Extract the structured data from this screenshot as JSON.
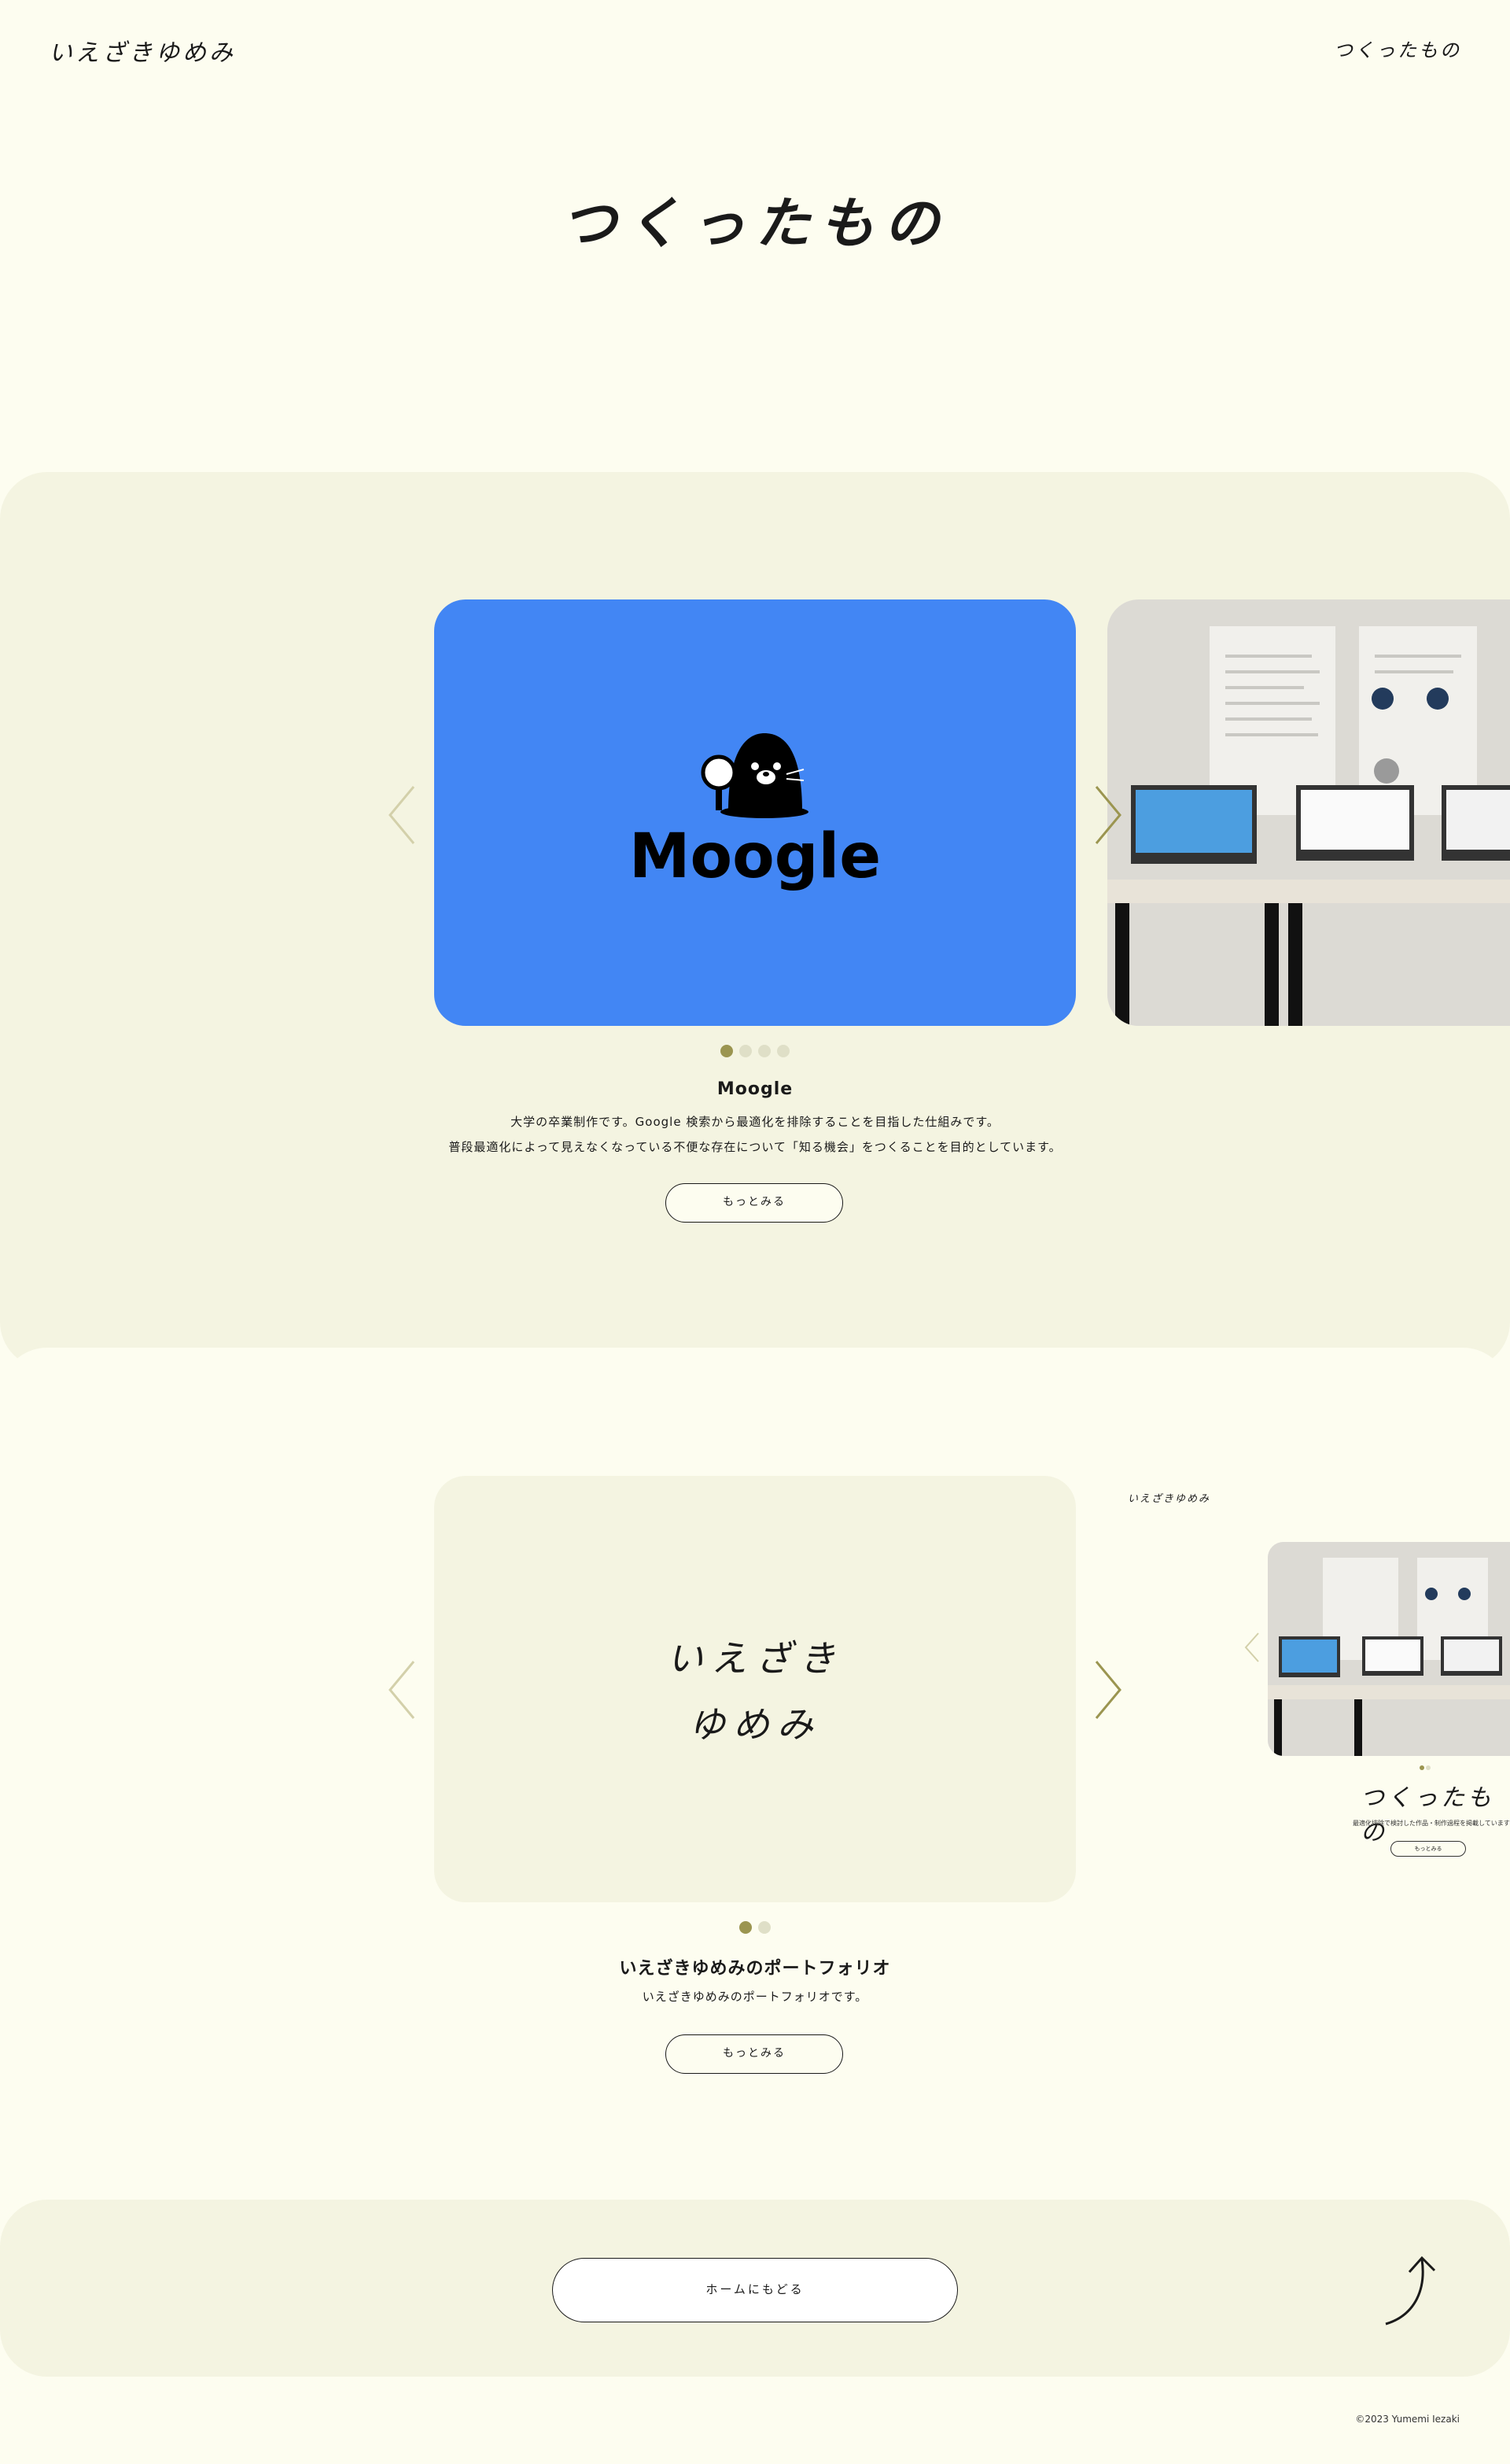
{
  "header": {
    "logo": "いえざきゆめみ",
    "nav_link": "つくったもの"
  },
  "page_title": "つくったもの",
  "works": [
    {
      "title": "Moogle",
      "card_logo": "Moogle",
      "description_lines": [
        "大学の卒業制作です。Google 検索から最適化を排除することを目指した仕組みです。",
        "普段最適化によって見えなくなっている不便な存在について「知る機会」をつくることを目的としています。"
      ],
      "button": "もっとみる",
      "slide_count": 4,
      "active_slide": 1
    },
    {
      "title": "いえざきゆめみのポートフォリオ",
      "card_logo_line1": "いえざき",
      "card_logo_line2": "ゆめみ",
      "description_lines": [
        "いえざきゆめみのポートフォリオです。"
      ],
      "button": "もっとみる",
      "slide_count": 2,
      "active_slide": 1,
      "preview": {
        "logo": "いえざきゆめみ",
        "title": "つくったもの",
        "desc": "最適化排除で検討した作品・制作過程を掲載しています",
        "button": "もっとみる"
      }
    }
  ],
  "footer": {
    "home_button": "ホームにもどる",
    "copyright": "©2023 Yumemi Iezaki"
  },
  "colors": {
    "background": "#fdfdf0",
    "band": "#f4f4e1",
    "card_blue": "#4286f4",
    "accent": "#9b9550"
  }
}
